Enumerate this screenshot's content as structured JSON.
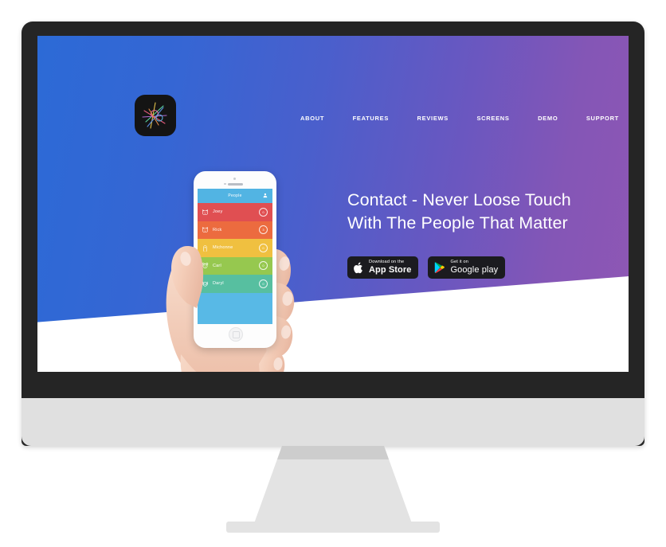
{
  "device": {
    "type": "imac-desktop-monitor",
    "frame_color": "#252525",
    "body_color": "#e0e0e0"
  },
  "site": {
    "background_gradient_from": "#2c6ad6",
    "background_gradient_to": "#8f57b4",
    "logo": {
      "name": "app-logo",
      "alt": "Contact app icon"
    },
    "nav": [
      {
        "label": "ABOUT"
      },
      {
        "label": "FEATURES"
      },
      {
        "label": "REVIEWS"
      },
      {
        "label": "SCREENS"
      },
      {
        "label": "DEMO"
      },
      {
        "label": "SUPPORT"
      }
    ],
    "settings_button": {
      "icon": "gear-icon",
      "color": "#3d78e0"
    },
    "hero": {
      "headline_line1": "Contact - Never Loose Touch",
      "headline_line2": "With The People That Matter",
      "badges": [
        {
          "id": "app-store",
          "icon": "apple-icon",
          "small": "Download on the",
          "big": "App Store"
        },
        {
          "id": "google-play",
          "icon": "play-icon",
          "small": "Get it on",
          "big": "Google play"
        }
      ]
    }
  },
  "phone": {
    "app": {
      "header_title": "People",
      "header_color": "#52b4e3",
      "add_icon": "add-person-icon",
      "contacts": [
        {
          "name": "Joey",
          "count": "0",
          "color": "#e04f52",
          "icon": "cat-face-icon"
        },
        {
          "name": "Rick",
          "count": "3",
          "color": "#ec6b3f",
          "icon": "cat-face-icon"
        },
        {
          "name": "Michonne",
          "count": "0",
          "color": "#f0c040",
          "icon": "owl-face-icon"
        },
        {
          "name": "Carl",
          "count": "0",
          "color": "#96c martial",
          "icon": "bear-face-icon"
        },
        {
          "name": "Daryl",
          "count": "0",
          "color": "#57bfa0",
          "icon": "dog-face-icon"
        }
      ]
    }
  }
}
